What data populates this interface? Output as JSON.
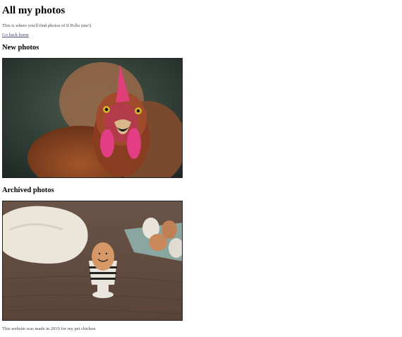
{
  "page": {
    "title": "All my photos",
    "intro": "This is where you'll find photos of Il Pollo (me!)",
    "back_link": "Go back home"
  },
  "sections": {
    "new": {
      "heading": "New photos"
    },
    "archived": {
      "heading": "Archived photos"
    }
  },
  "footer": {
    "text": "This website was made in 2019 for my pet chicken"
  },
  "colors": {
    "link": "#4a4a7a",
    "text_muted": "#444444"
  }
}
